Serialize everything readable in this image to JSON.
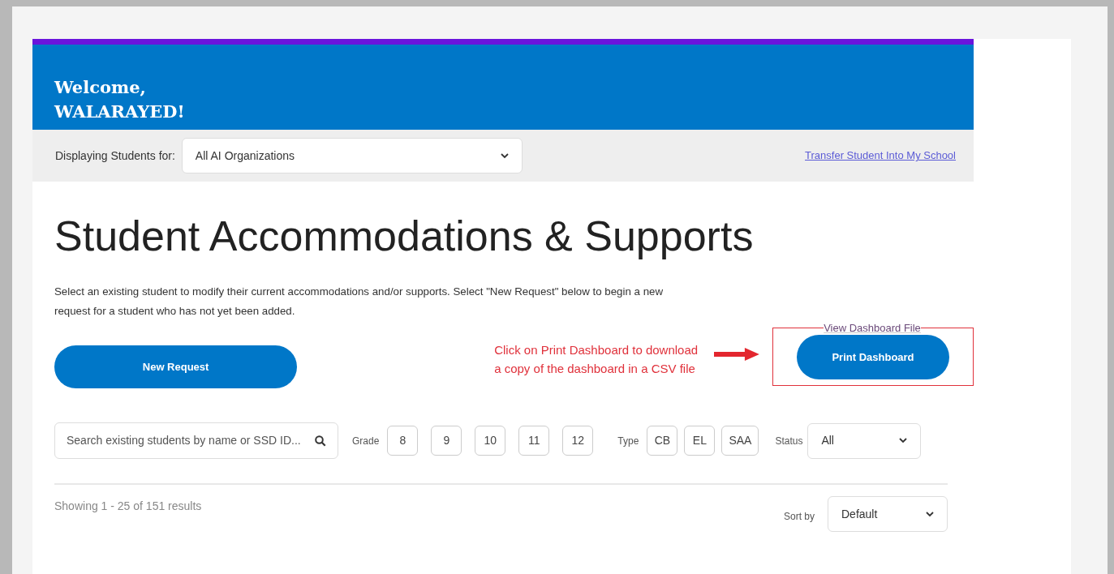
{
  "header": {
    "greeting_lines": [
      "Welcome,",
      "WALARAYED!"
    ]
  },
  "org_bar": {
    "label": "Displaying Students for:",
    "select_value": "All AI Organizations",
    "transfer_link": "Transfer Student Into My School"
  },
  "page_title": "Student Accommodations & Supports",
  "intro": "Select an existing student to modify their current accommodations and/or supports. Select \"New Request\" below to begin a new request for a student who has not yet been added.",
  "new_request_button": "New Request",
  "annotation": {
    "text_lines": [
      "Click on Print Dashboard to download",
      "a copy of the dashboard in a CSV file"
    ]
  },
  "view_file_link": "View Dashboard File",
  "print_button": "Print Dashboard",
  "search": {
    "placeholder": "Search existing students by name or SSD ID..."
  },
  "grade_filter": {
    "label": "Grade",
    "options": [
      {
        "label": "8",
        "selected": false
      },
      {
        "label": "9",
        "selected": false
      },
      {
        "label": "10",
        "selected": false
      },
      {
        "label": "11",
        "selected": false
      },
      {
        "label": "12",
        "selected": false
      }
    ]
  },
  "type_filter": {
    "label": "Type",
    "options": [
      {
        "label": "CB",
        "selected": false
      },
      {
        "label": "EL",
        "selected": false
      },
      {
        "label": "SAA",
        "selected": false
      }
    ]
  },
  "status_filter": {
    "label": "Status",
    "value": "All"
  },
  "results": {
    "summary": "Showing 1 - 25 of 151 results",
    "sort_label": "Sort by",
    "sort_value": "Default"
  }
}
